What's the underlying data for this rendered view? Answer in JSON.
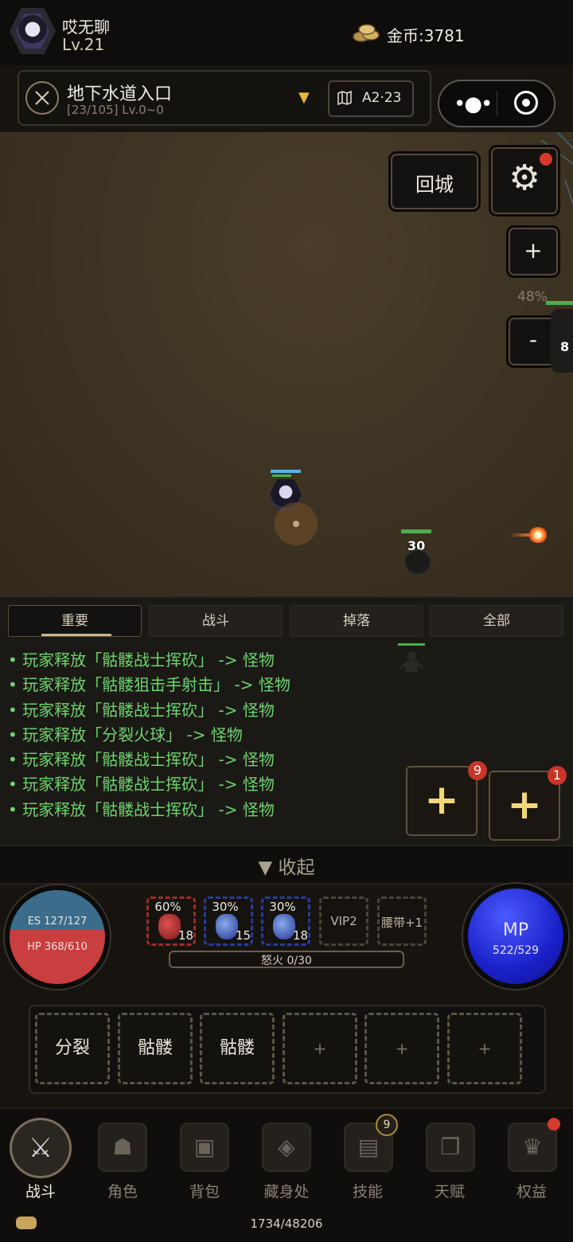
{
  "player": {
    "name": "哎无聊",
    "level": "Lv.21"
  },
  "currency": {
    "label": "金币:3781"
  },
  "location": {
    "name": "地下水道入口",
    "sub": "[23/105] Lv.0~0",
    "map_code": "A2·23"
  },
  "field": {
    "return_label": "回城",
    "zoom_in": "+",
    "zoom_out": "-",
    "zoom_pct": "48%",
    "mob_level": "30",
    "mob2_level": "8"
  },
  "log_tabs": [
    "重要",
    "战斗",
    "掉落",
    "全部"
  ],
  "log_lines": [
    "• 玩家释放「骷髅战士挥砍」 -> 怪物",
    "• 玩家释放「骷髅狙击手射击」 -> 怪物",
    "• 玩家释放「骷髅战士挥砍」 -> 怪物",
    "• 玩家释放「分裂火球」 -> 怪物",
    "• 玩家释放「骷髅战士挥砍」 -> 怪物",
    "• 玩家释放「骷髅战士挥砍」 -> 怪物",
    "• 玩家释放「骷髅战士挥砍」 -> 怪物"
  ],
  "quick_slots": [
    {
      "plus": "+",
      "badge": "9"
    },
    {
      "plus": "+",
      "badge": "1"
    }
  ],
  "collapse_label": "▼ 收起",
  "status": {
    "es": "ES 127/127",
    "hp": "HP 368/610",
    "mp_title": "MP",
    "mp": "522/529",
    "rage": "怒火 0/30"
  },
  "potions": [
    {
      "pct": "60%",
      "count": "18",
      "kind": "red"
    },
    {
      "pct": "30%",
      "count": "15",
      "kind": "blue"
    },
    {
      "pct": "30%",
      "count": "18",
      "kind": "blue"
    }
  ],
  "slot_labels": {
    "vip": "VIP2",
    "belt": "腰带+1"
  },
  "skills": [
    "分裂",
    "骷髅",
    "骷髅",
    "+",
    "+",
    "+"
  ],
  "nav": [
    {
      "label": "战斗",
      "icon": "crossed-swords-icon"
    },
    {
      "label": "角色",
      "icon": "helmet-icon"
    },
    {
      "label": "背包",
      "icon": "chest-icon"
    },
    {
      "label": "藏身处",
      "icon": "hideout-icon"
    },
    {
      "label": "技能",
      "icon": "book-icon",
      "badge": "9"
    },
    {
      "label": "天赋",
      "icon": "cards-icon"
    },
    {
      "label": "权益",
      "icon": "crown-icon"
    }
  ],
  "exp_text": "1734/48206",
  "colors": {
    "accent_gold": "#e6b830",
    "log_green": "#6fd36f",
    "hp_red": "#c93e3e",
    "mp_blue": "#1a20c8",
    "badge_red": "#c93428"
  }
}
